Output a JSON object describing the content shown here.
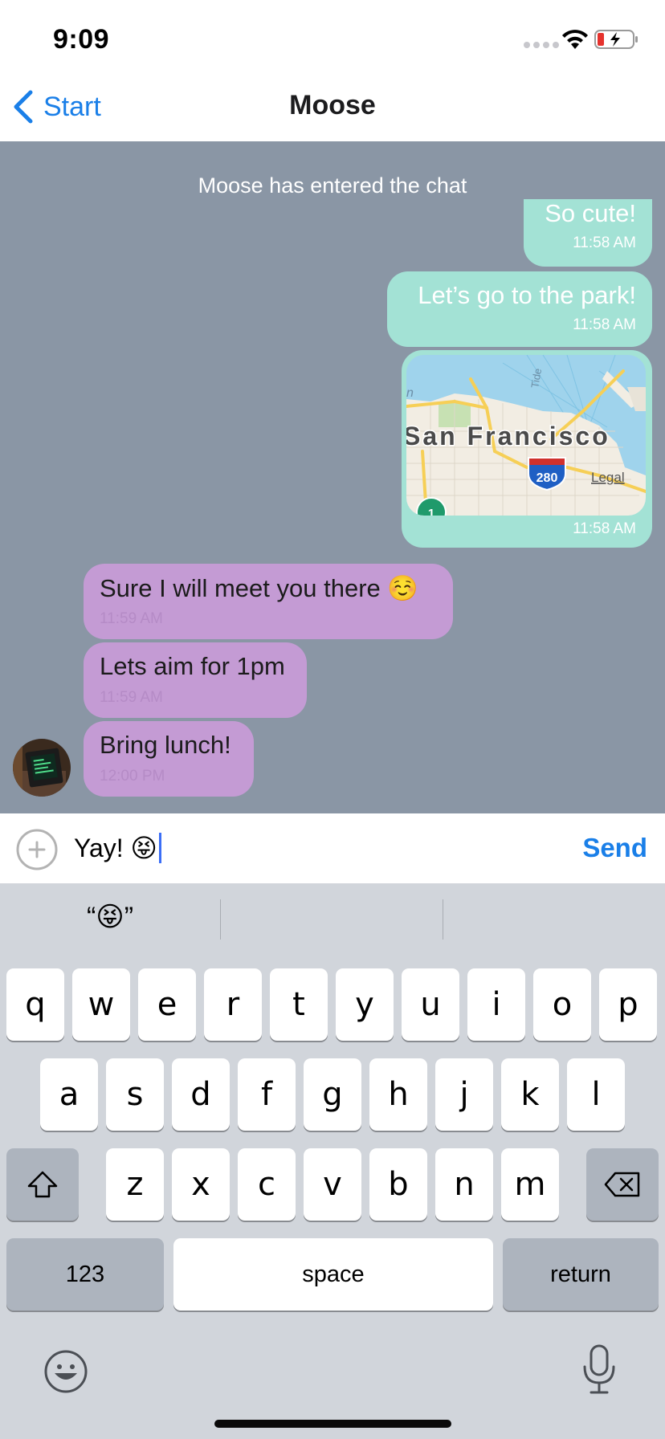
{
  "status_bar": {
    "time": "9:09"
  },
  "nav": {
    "back_label": "Start",
    "title": "Moose"
  },
  "chat": {
    "system_message": "Moose has entered the chat",
    "outgoing": [
      {
        "text": "So cute!",
        "time": "11:58 AM"
      },
      {
        "text": "Let’s go to the park!",
        "time": "11:58 AM"
      },
      {
        "type": "map",
        "map_label": "San Francisco",
        "map_shield": "280",
        "map_route": "1",
        "map_legal": "Legal",
        "map_street": "Tide",
        "map_water_letter": "n",
        "time": "11:58 AM"
      }
    ],
    "incoming": [
      {
        "text": "Sure I will meet you there ☺️",
        "time": "11:59 AM"
      },
      {
        "text": "Lets aim for 1pm",
        "time": "11:59 AM"
      },
      {
        "text": "Bring lunch!",
        "time": "12:00 PM"
      }
    ]
  },
  "composer": {
    "text": "Yay! 😝",
    "send_label": "Send"
  },
  "keyboard": {
    "suggestions": [
      "“😝”",
      "",
      ""
    ],
    "row1": [
      "q",
      "w",
      "e",
      "r",
      "t",
      "y",
      "u",
      "i",
      "o",
      "p"
    ],
    "row2": [
      "a",
      "s",
      "d",
      "f",
      "g",
      "h",
      "j",
      "k",
      "l"
    ],
    "row3": [
      "z",
      "x",
      "c",
      "v",
      "b",
      "n",
      "m"
    ],
    "numbers_label": "123",
    "space_label": "space",
    "return_label": "return"
  },
  "colors": {
    "accent": "#1a7fe8",
    "chat_background": "#8a96a5",
    "outgoing_bubble": "#a3e2d5",
    "incoming_bubble": "#c49bd4"
  },
  "icons": [
    "back-chevron-icon",
    "wifi-icon",
    "battery-charging-icon",
    "plus-icon",
    "shift-icon",
    "backspace-icon",
    "emoji-icon",
    "microphone-icon"
  ]
}
